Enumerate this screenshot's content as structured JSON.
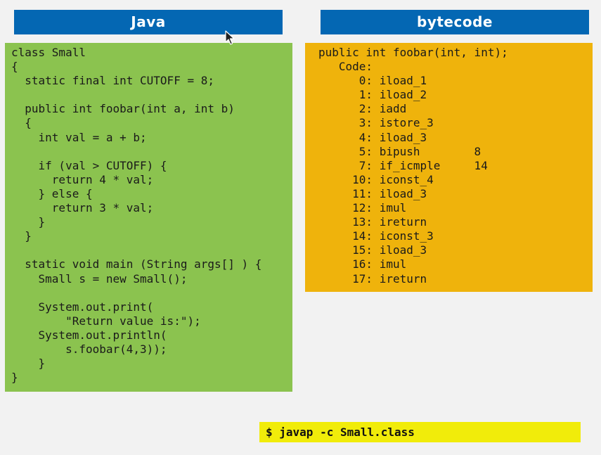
{
  "java": {
    "title": "Java",
    "code": "class Small\n{\n  static final int CUTOFF = 8;\n\n  public int foobar(int a, int b)\n  {\n    int val = a + b;\n\n    if (val > CUTOFF) {\n      return 4 * val;\n    } else {\n      return 3 * val;\n    }\n  }\n\n  static void main (String args[] ) {\n    Small s = new Small();\n\n    System.out.print(\n        \"Return value is:\");\n    System.out.println(\n        s.foobar(4,3));\n    }\n}"
  },
  "bytecode": {
    "title": "bytecode",
    "code": "public int foobar(int, int);\n   Code:\n      0: iload_1\n      1: iload_2\n      2: iadd\n      3: istore_3\n      4: iload_3\n      5: bipush        8\n      7: if_icmple     14\n     10: iconst_4\n     11: iload_3\n     12: imul\n     13: ireturn\n     14: iconst_3\n     15: iload_3\n     16: imul\n     17: ireturn"
  },
  "command": {
    "text": "$ javap -c Small.class"
  },
  "colors": {
    "header_bg": "#0467b3",
    "java_bg": "#8bc34f",
    "bytecode_bg": "#efb30c",
    "command_bg": "#f1ec0a"
  },
  "icons": {
    "cursor": "mouse-pointer-icon"
  }
}
